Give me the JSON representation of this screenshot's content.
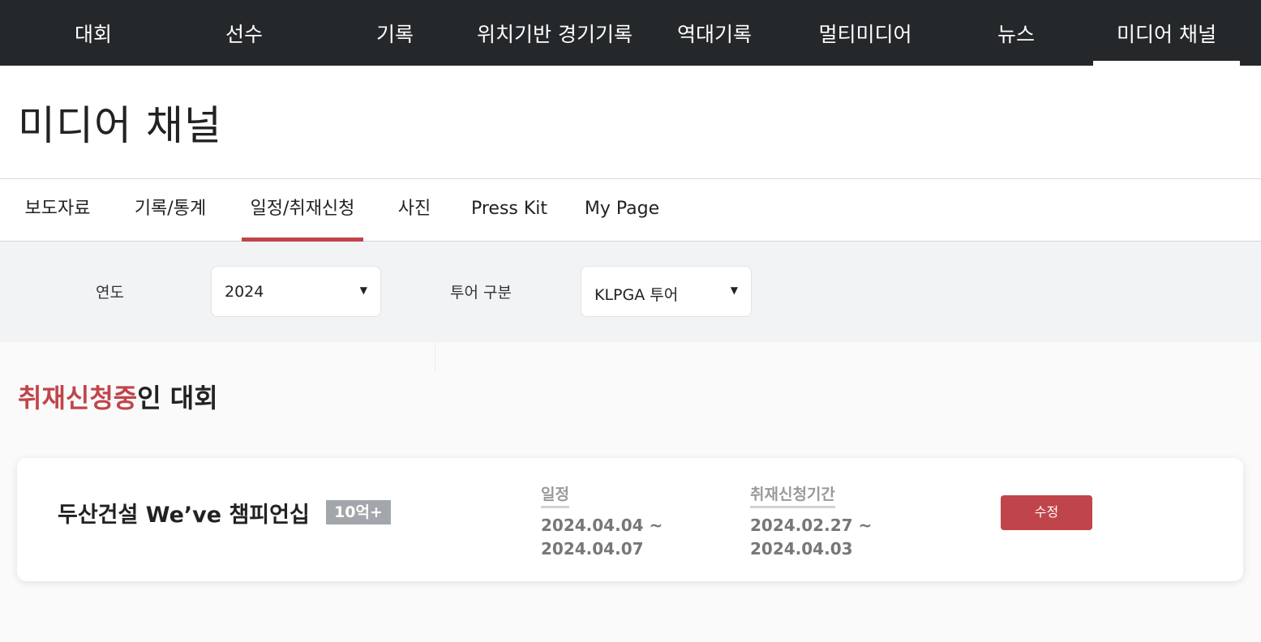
{
  "topnav": {
    "items": [
      {
        "label": "대회"
      },
      {
        "label": "선수"
      },
      {
        "label": "기록"
      },
      {
        "label": "위치기반 경기기록"
      },
      {
        "label": "역대기록"
      },
      {
        "label": "멀티미디어"
      },
      {
        "label": "뉴스"
      },
      {
        "label": "미디어 채널",
        "active": true
      }
    ]
  },
  "page": {
    "title": "미디어 채널"
  },
  "subtabs": {
    "items": [
      {
        "label": "보도자료"
      },
      {
        "label": "기록/통계"
      },
      {
        "label": "일정/취재신청",
        "active": true
      },
      {
        "label": "사진"
      },
      {
        "label": "Press Kit"
      },
      {
        "label": "My Page"
      }
    ]
  },
  "filters": {
    "year_label": "연도",
    "year_value": "2024",
    "tour_label": "투어 구분",
    "tour_value": "KLPGA 투어"
  },
  "section": {
    "heading_accent": "취재신청중",
    "heading_rest": "인 대회"
  },
  "event": {
    "name": "두산건설 We’ve 챔피언십",
    "prize_badge": "10억+",
    "schedule_label": "일정",
    "schedule_start": "2024.04.04 ~",
    "schedule_end": "2024.04.07",
    "press_period_label": "취재신청기간",
    "press_period_start": "2024.02.27 ~",
    "press_period_end": "2024.04.03",
    "edit_label": "수정"
  },
  "colors": {
    "nav_bg": "#24282b",
    "accent": "#c0454b",
    "badge_bg": "#a3a6ab",
    "filter_bg": "#f2f3f5"
  }
}
